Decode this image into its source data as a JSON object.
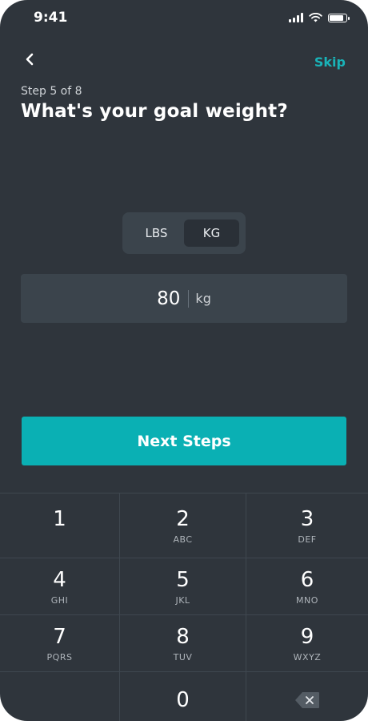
{
  "status_bar": {
    "time": "9:41"
  },
  "nav": {
    "back_icon": "chevron-left-icon",
    "skip_label": "Skip"
  },
  "header": {
    "step": "Step 5 of 8",
    "title": "What's your goal weight?"
  },
  "unit_toggle": {
    "options": [
      "LBS",
      "KG"
    ],
    "selected": "KG"
  },
  "weight_input": {
    "value": "80",
    "unit": "kg"
  },
  "next_button": {
    "label": "Next Steps"
  },
  "colors": {
    "background": "#2f353c",
    "accent": "#0ab0b4",
    "panel": "#3b444c"
  },
  "keypad": {
    "keys": [
      {
        "num": "1",
        "letters": ""
      },
      {
        "num": "2",
        "letters": "ABC"
      },
      {
        "num": "3",
        "letters": "DEF"
      },
      {
        "num": "4",
        "letters": "GHI"
      },
      {
        "num": "5",
        "letters": "JKL"
      },
      {
        "num": "6",
        "letters": "MNO"
      },
      {
        "num": "7",
        "letters": "PQRS"
      },
      {
        "num": "8",
        "letters": "TUV"
      },
      {
        "num": "9",
        "letters": "WXYZ"
      },
      {
        "num": "0",
        "letters": ""
      }
    ],
    "delete_icon": "backspace-icon"
  }
}
